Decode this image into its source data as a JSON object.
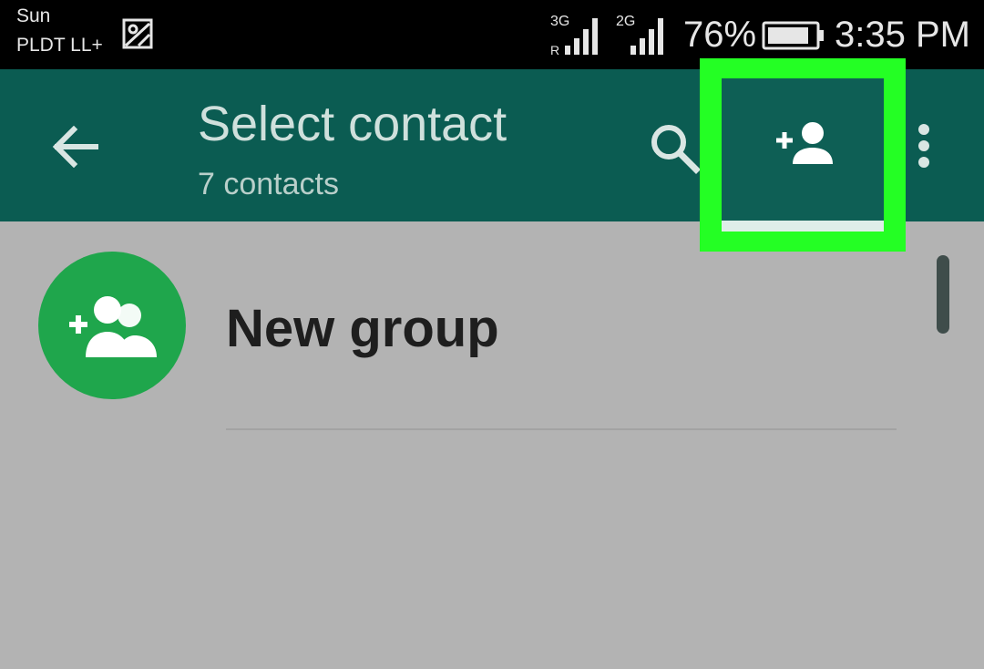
{
  "status_bar": {
    "carrier_line1": "Sun",
    "carrier_line2": "PLDT LL+",
    "notification_icon": "gallery-icon",
    "network_1": "3G",
    "network_1_roaming": "R",
    "network_2": "2G",
    "battery_percent": "76%",
    "time": "3:35 PM"
  },
  "toolbar": {
    "back_icon": "arrow-left-icon",
    "title": "Select contact",
    "subtitle": "7 contacts",
    "search_icon": "search-icon",
    "add_contact_icon": "add-person-icon",
    "more_icon": "more-vertical-icon"
  },
  "list": {
    "new_group_icon": "add-group-icon",
    "new_group_label": "New group"
  },
  "colors": {
    "toolbar": "#0b5c52",
    "highlight": "#24ff24",
    "avatar": "#1fa64c",
    "list_background": "#b3b3b3"
  }
}
